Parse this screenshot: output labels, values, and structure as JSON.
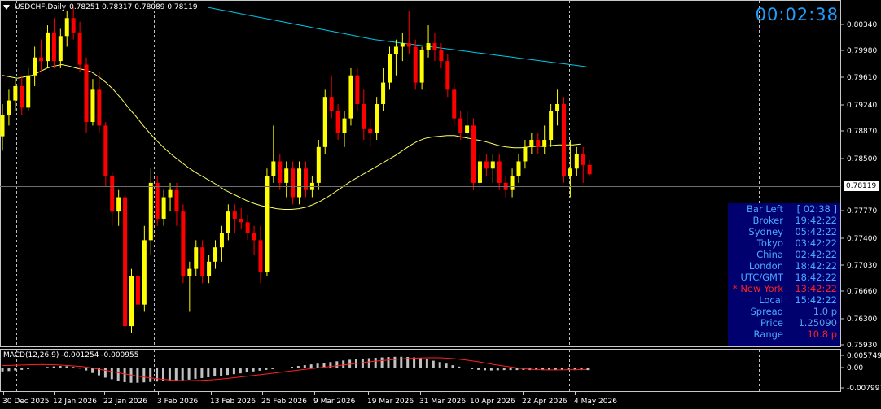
{
  "header": {
    "symbol": "USDCHF,Daily",
    "ohlc": "0.78251 0.78317 0.78089 0.78119"
  },
  "timer": "00:02:38",
  "price_axis": {
    "ticks": [
      "0.80340",
      "0.79980",
      "0.79610",
      "0.79240",
      "0.78870",
      "0.78500",
      "0.77770",
      "0.77400",
      "0.77030",
      "0.76660",
      "0.76300",
      "0.75930"
    ],
    "current_price": "0.78119"
  },
  "macd": {
    "label": "MACD(12,26,9) -0.001254 -0.000955",
    "ticks": [
      "0.005749",
      "0.00",
      "-0.007997"
    ]
  },
  "date_axis": [
    "30 Dec 2025",
    "12 Jan 2026",
    "22 Jan 2026",
    "3 Feb 2026",
    "13 Feb 2026",
    "25 Feb 2026",
    "9 Mar 2026",
    "19 Mar 2026",
    "31 Mar 2026",
    "10 Apr 2026",
    "22 Apr 2026",
    "4 May 2026"
  ],
  "info_panel": {
    "rows": [
      {
        "key": "Bar Left",
        "value": "[ 02:38 ]",
        "highlight": false
      },
      {
        "key": "Broker",
        "value": "19:42:22",
        "highlight": false
      },
      {
        "key": "Sydney",
        "value": "05:42:22",
        "highlight": false
      },
      {
        "key": "Tokyo",
        "value": "03:42:22",
        "highlight": false
      },
      {
        "key": "China",
        "value": "02:42:22",
        "highlight": false
      },
      {
        "key": "London",
        "value": "18:42:22",
        "highlight": false
      },
      {
        "key": "UTC/GMT",
        "value": "18:42:22",
        "highlight": false
      },
      {
        "key": "* New York",
        "value": "13:42:22",
        "highlight": true
      },
      {
        "key": "Local",
        "value": "15:42:22",
        "highlight": false
      },
      {
        "key": "Spread",
        "value": "1.0 p",
        "highlight": false
      },
      {
        "key": "Price",
        "value": "1.25090",
        "highlight": false
      },
      {
        "key": "Range",
        "value": "10.8 p",
        "highlight": true
      }
    ]
  },
  "colors": {
    "bull": "#ffff00",
    "bear": "#ff0000",
    "ma_fast": "#ffff66",
    "ma_slow": "#00c8e6",
    "macd_signal": "#ff2020",
    "macd_hist": "#c0c0c0",
    "timer": "#1e9fff",
    "panel_bg": "#00006e",
    "panel_text": "#4aa8ff",
    "panel_highlight": "#ff2020"
  },
  "chart_data": {
    "type": "candlestick",
    "y_range": [
      0.7574,
      0.8053
    ],
    "candles": [
      [
        0.7865,
        0.791,
        0.7845,
        0.7895
      ],
      [
        0.7895,
        0.793,
        0.788,
        0.7915
      ],
      [
        0.7915,
        0.7945,
        0.79,
        0.7935
      ],
      [
        0.7935,
        0.795,
        0.7895,
        0.7905
      ],
      [
        0.7905,
        0.796,
        0.79,
        0.795
      ],
      [
        0.795,
        0.799,
        0.7935,
        0.7975
      ],
      [
        0.7975,
        0.8,
        0.7955,
        0.797
      ],
      [
        0.797,
        0.802,
        0.796,
        0.801
      ],
      [
        0.801,
        0.803,
        0.796,
        0.797
      ],
      [
        0.797,
        0.8015,
        0.796,
        0.8005
      ],
      [
        0.8005,
        0.804,
        0.799,
        0.803
      ],
      [
        0.803,
        0.8045,
        0.8,
        0.801
      ],
      [
        0.801,
        0.8025,
        0.7955,
        0.7965
      ],
      [
        0.7965,
        0.7975,
        0.787,
        0.7885
      ],
      [
        0.7885,
        0.7945,
        0.788,
        0.793
      ],
      [
        0.793,
        0.7955,
        0.787,
        0.788
      ],
      [
        0.788,
        0.7885,
        0.7795,
        0.781
      ],
      [
        0.781,
        0.7815,
        0.774,
        0.776
      ],
      [
        0.776,
        0.779,
        0.774,
        0.778
      ],
      [
        0.778,
        0.78,
        0.759,
        0.76
      ],
      [
        0.76,
        0.768,
        0.759,
        0.767
      ],
      [
        0.767,
        0.768,
        0.762,
        0.763
      ],
      [
        0.763,
        0.774,
        0.762,
        0.772
      ],
      [
        0.772,
        0.782,
        0.77,
        0.78
      ],
      [
        0.78,
        0.781,
        0.774,
        0.775
      ],
      [
        0.775,
        0.779,
        0.774,
        0.778
      ],
      [
        0.778,
        0.78,
        0.776,
        0.779
      ],
      [
        0.779,
        0.78,
        0.774,
        0.776
      ],
      [
        0.776,
        0.777,
        0.766,
        0.767
      ],
      [
        0.767,
        0.769,
        0.762,
        0.768
      ],
      [
        0.768,
        0.772,
        0.767,
        0.771
      ],
      [
        0.771,
        0.772,
        0.766,
        0.767
      ],
      [
        0.767,
        0.77,
        0.766,
        0.769
      ],
      [
        0.769,
        0.772,
        0.768,
        0.771
      ],
      [
        0.771,
        0.774,
        0.769,
        0.773
      ],
      [
        0.773,
        0.777,
        0.772,
        0.776
      ],
      [
        0.776,
        0.777,
        0.773,
        0.775
      ],
      [
        0.775,
        0.7765,
        0.7735,
        0.7745
      ],
      [
        0.7745,
        0.7755,
        0.772,
        0.773
      ],
      [
        0.773,
        0.774,
        0.77,
        0.772
      ],
      [
        0.772,
        0.774,
        0.766,
        0.7675
      ],
      [
        0.7675,
        0.782,
        0.767,
        0.781
      ],
      [
        0.781,
        0.788,
        0.78,
        0.783
      ],
      [
        0.783,
        0.784,
        0.779,
        0.78
      ],
      [
        0.78,
        0.783,
        0.778,
        0.782
      ],
      [
        0.782,
        0.783,
        0.777,
        0.778
      ],
      [
        0.778,
        0.783,
        0.777,
        0.782
      ],
      [
        0.782,
        0.783,
        0.778,
        0.779
      ],
      [
        0.779,
        0.781,
        0.778,
        0.78
      ],
      [
        0.78,
        0.786,
        0.779,
        0.785
      ],
      [
        0.785,
        0.793,
        0.784,
        0.792
      ],
      [
        0.792,
        0.795,
        0.789,
        0.79
      ],
      [
        0.79,
        0.791,
        0.786,
        0.787
      ],
      [
        0.787,
        0.79,
        0.785,
        0.789
      ],
      [
        0.789,
        0.796,
        0.788,
        0.795
      ],
      [
        0.795,
        0.796,
        0.79,
        0.791
      ],
      [
        0.791,
        0.793,
        0.786,
        0.7875
      ],
      [
        0.7875,
        0.789,
        0.785,
        0.787
      ],
      [
        0.787,
        0.792,
        0.786,
        0.791
      ],
      [
        0.791,
        0.796,
        0.79,
        0.794
      ],
      [
        0.794,
        0.799,
        0.793,
        0.798
      ],
      [
        0.798,
        0.8,
        0.795,
        0.799
      ],
      [
        0.799,
        0.801,
        0.797,
        0.7995
      ],
      [
        0.7995,
        0.804,
        0.798,
        0.799
      ],
      [
        0.799,
        0.8,
        0.793,
        0.794
      ],
      [
        0.794,
        0.799,
        0.793,
        0.7985
      ],
      [
        0.7985,
        0.802,
        0.7975,
        0.7995
      ],
      [
        0.7995,
        0.801,
        0.797,
        0.7985
      ],
      [
        0.7985,
        0.7995,
        0.796,
        0.797
      ],
      [
        0.797,
        0.798,
        0.792,
        0.793
      ],
      [
        0.793,
        0.794,
        0.788,
        0.789
      ],
      [
        0.789,
        0.79,
        0.786,
        0.787
      ],
      [
        0.787,
        0.79,
        0.786,
        0.788
      ],
      [
        0.788,
        0.789,
        0.779,
        0.78
      ],
      [
        0.78,
        0.784,
        0.779,
        0.783
      ],
      [
        0.783,
        0.784,
        0.781,
        0.782
      ],
      [
        0.782,
        0.784,
        0.78,
        0.783
      ],
      [
        0.783,
        0.784,
        0.779,
        0.78
      ],
      [
        0.78,
        0.781,
        0.778,
        0.779
      ],
      [
        0.779,
        0.782,
        0.778,
        0.781
      ],
      [
        0.781,
        0.784,
        0.78,
        0.783
      ],
      [
        0.783,
        0.786,
        0.782,
        0.785
      ],
      [
        0.785,
        0.787,
        0.784,
        0.786
      ],
      [
        0.786,
        0.787,
        0.784,
        0.785
      ],
      [
        0.785,
        0.788,
        0.784,
        0.786
      ],
      [
        0.786,
        0.791,
        0.785,
        0.79
      ],
      [
        0.79,
        0.793,
        0.788,
        0.791
      ],
      [
        0.791,
        0.792,
        0.78,
        0.781
      ],
      [
        0.781,
        0.786,
        0.778,
        0.782
      ],
      [
        0.782,
        0.785,
        0.781,
        0.784
      ],
      [
        0.784,
        0.785,
        0.78,
        0.7825
      ],
      [
        0.7825,
        0.7832,
        0.7809,
        0.7812
      ]
    ],
    "ma_fast": [
      0.795,
      0.7948,
      0.7946,
      0.7948,
      0.795,
      0.7955,
      0.796,
      0.7963,
      0.7965,
      0.7963,
      0.796,
      0.7958,
      0.7955,
      0.7948,
      0.794,
      0.793,
      0.7918,
      0.7905,
      0.7893,
      0.788,
      0.7868,
      0.7857,
      0.7847,
      0.7838,
      0.783,
      0.7822,
      0.7815,
      0.7809,
      0.7803,
      0.7797,
      0.779,
      0.7785,
      0.778,
      0.7775,
      0.7771,
      0.7768,
      0.7766,
      0.7764,
      0.7763,
      0.7763,
      0.7764,
      0.7766,
      0.777,
      0.7775,
      0.7781,
      0.7788,
      0.7795,
      0.7802,
      0.7808,
      0.7814,
      0.782,
      0.7826,
      0.7832,
      0.7838,
      0.7845,
      0.7852,
      0.7858,
      0.7862,
      0.7864,
      0.7865,
      0.7866,
      0.7866,
      0.7864,
      0.7862,
      0.786,
      0.7858,
      0.7855,
      0.7852,
      0.785,
      0.7849,
      0.7849,
      0.785,
      0.7851,
      0.7851,
      0.7852,
      0.7853,
      0.7853,
      0.7853,
      0.7854
    ],
    "ma_slow": [
      0.8045,
      0.8042,
      0.8039,
      0.8036,
      0.8033,
      0.803,
      0.8027,
      0.8024,
      0.8021,
      0.8018,
      0.8015,
      0.8012,
      0.8009,
      0.8006,
      0.8003,
      0.8,
      0.7998,
      0.7996,
      0.7994,
      0.7992,
      0.799,
      0.7988,
      0.7986,
      0.7984,
      0.7982,
      0.798,
      0.7978,
      0.7976,
      0.7974,
      0.7972,
      0.797,
      0.7968,
      0.7966,
      0.7964,
      0.7962
    ],
    "macd_hist": [
      -0.002,
      -0.0018,
      -0.0015,
      -0.0012,
      -0.0008,
      -0.0004,
      0.0,
      0.0003,
      0.0006,
      0.0008,
      0.0007,
      0.0003,
      -0.0005,
      -0.0015,
      -0.0028,
      -0.004,
      -0.0052,
      -0.006,
      -0.0068,
      -0.0075,
      -0.0078,
      -0.0078,
      -0.0076,
      -0.0074,
      -0.0072,
      -0.007,
      -0.0068,
      -0.0066,
      -0.0064,
      -0.0062,
      -0.0058,
      -0.0054,
      -0.005,
      -0.0046,
      -0.0042,
      -0.0038,
      -0.0034,
      -0.003,
      -0.0025,
      -0.002,
      -0.0016,
      -0.0012,
      -0.0008,
      -0.0004,
      0.0,
      0.0004,
      0.0008,
      0.0012,
      0.0016,
      0.002,
      0.0024,
      0.0028,
      0.0032,
      0.0036,
      0.004,
      0.0043,
      0.0046,
      0.0048,
      0.005,
      0.0052,
      0.0054,
      0.0055,
      0.0055,
      0.0054,
      0.0052,
      0.0048,
      0.0042,
      0.0035,
      0.0028,
      0.002,
      0.0012,
      0.0005,
      -0.0002,
      -0.0008,
      -0.0012,
      -0.0014,
      -0.0015,
      -0.0014,
      -0.0013,
      -0.0013,
      -0.0013,
      -0.0012,
      -0.0013,
      -0.0013,
      -0.0013,
      -0.0013,
      -0.0013,
      -0.0012,
      -0.0013,
      -0.0013,
      -0.0013,
      -0.0013
    ],
    "macd_signal": [
      0.001,
      0.0012,
      0.0014,
      0.0016,
      0.0014,
      0.001,
      0.0005,
      -0.0005,
      -0.0018,
      -0.003,
      -0.0042,
      -0.0052,
      -0.006,
      -0.0066,
      -0.0068,
      -0.0066,
      -0.0062,
      -0.0056,
      -0.0048,
      -0.004,
      -0.0032,
      -0.0024,
      -0.0016,
      -0.0008,
      0.0,
      0.0008,
      0.0016,
      0.0024,
      0.0032,
      0.0038,
      0.0044,
      0.0048,
      0.005,
      0.005,
      0.0046,
      0.0038,
      0.0028,
      0.0016,
      0.0006,
      -0.0004,
      -0.001,
      -0.0012,
      -0.0012,
      -0.0011,
      -0.001
    ]
  }
}
